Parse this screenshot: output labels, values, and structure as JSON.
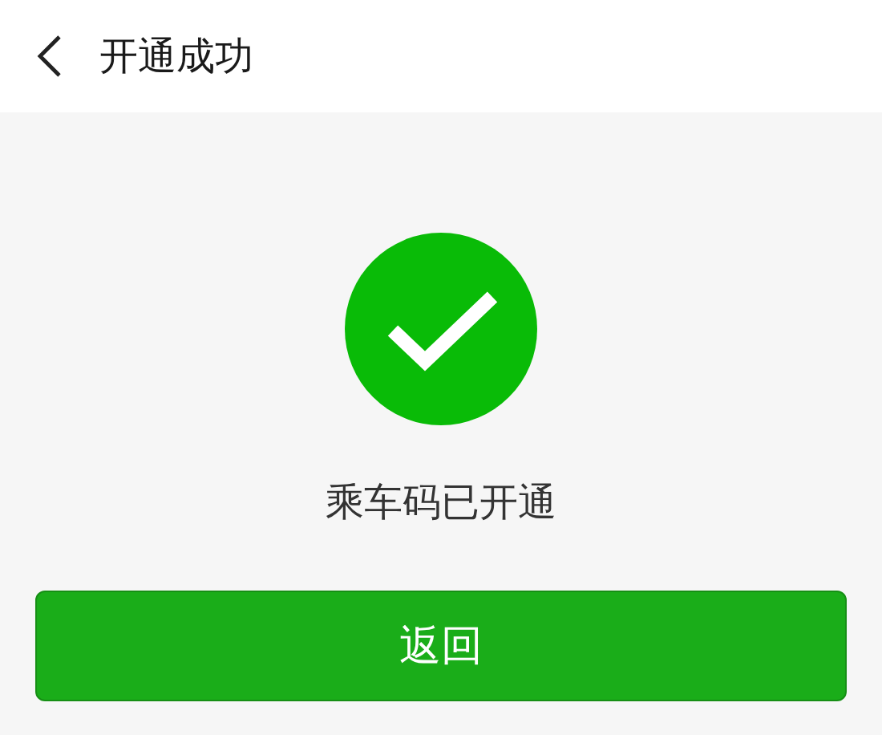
{
  "header": {
    "title": "开通成功"
  },
  "result": {
    "kind": "success",
    "message": "乘车码已开通"
  },
  "buttons": [
    {
      "label": "返回"
    }
  ]
}
